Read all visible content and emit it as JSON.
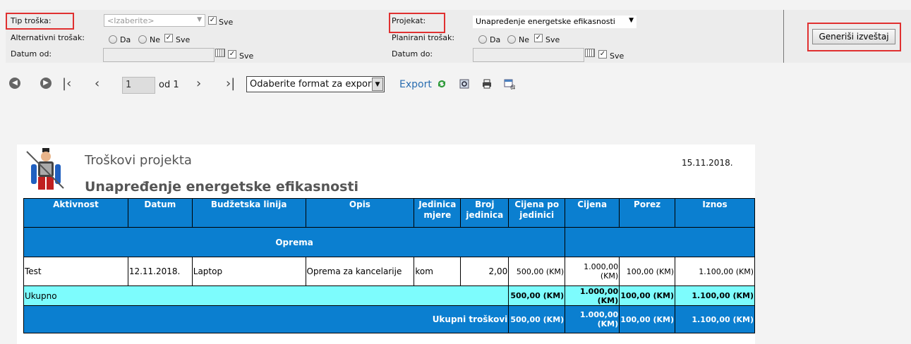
{
  "params": {
    "tip_troska_label": "Tip troška:",
    "tip_troska_value": "<Izaberite>",
    "alternativni_label": "Alternativni trošak:",
    "datum_od_label": "Datum od:",
    "projekat_label": "Projekat:",
    "projekat_value": "Unapređenje energetske efikasnosti",
    "planirani_label": "Planirani trošak:",
    "datum_do_label": "Datum do:",
    "da": "Da",
    "ne": "Ne",
    "sve": "Sve",
    "generate_button": "Generiši izveštaj"
  },
  "toolbar": {
    "page": "1",
    "of_text": "od 1",
    "export_format": "Odaberite format za export",
    "export_link": "Export"
  },
  "report": {
    "title": "Troškovi projekta",
    "subtitle": "Unapređenje energetske efikasnosti",
    "date": "15.11.2018.",
    "headers": [
      "Aktivnost",
      "Datum",
      "Budžetska linija",
      "Opis",
      "Jedinica mjere",
      "Broj jedinica",
      "Cijena po jedinici",
      "Cijena",
      "Porez",
      "Iznos"
    ],
    "group": "Oprema",
    "row": {
      "aktivnost": "Test",
      "datum": "12.11.2018.",
      "linija": "Laptop",
      "opis": "Oprema za kancelarije",
      "jedinica": "kom",
      "broj": "2,00",
      "cijena_po": "500,00 (KM)",
      "cijena": "1.000,00 (KM)",
      "porez": "100,00 (KM)",
      "iznos": "1.100,00 (KM)"
    },
    "ukupno": {
      "label": "Ukupno",
      "cijena_po": "500,00 (KM)",
      "cijena": "1.000,00 (KM)",
      "porez": "100,00 (KM)",
      "iznos": "1.100,00 (KM)"
    },
    "ukupni": {
      "label": "Ukupni troškovi",
      "cijena_po": "500,00 (KM)",
      "cijena": "1.000,00 (KM)",
      "porez": "100,00 (KM)",
      "iznos": "1.100,00 (KM)"
    }
  }
}
